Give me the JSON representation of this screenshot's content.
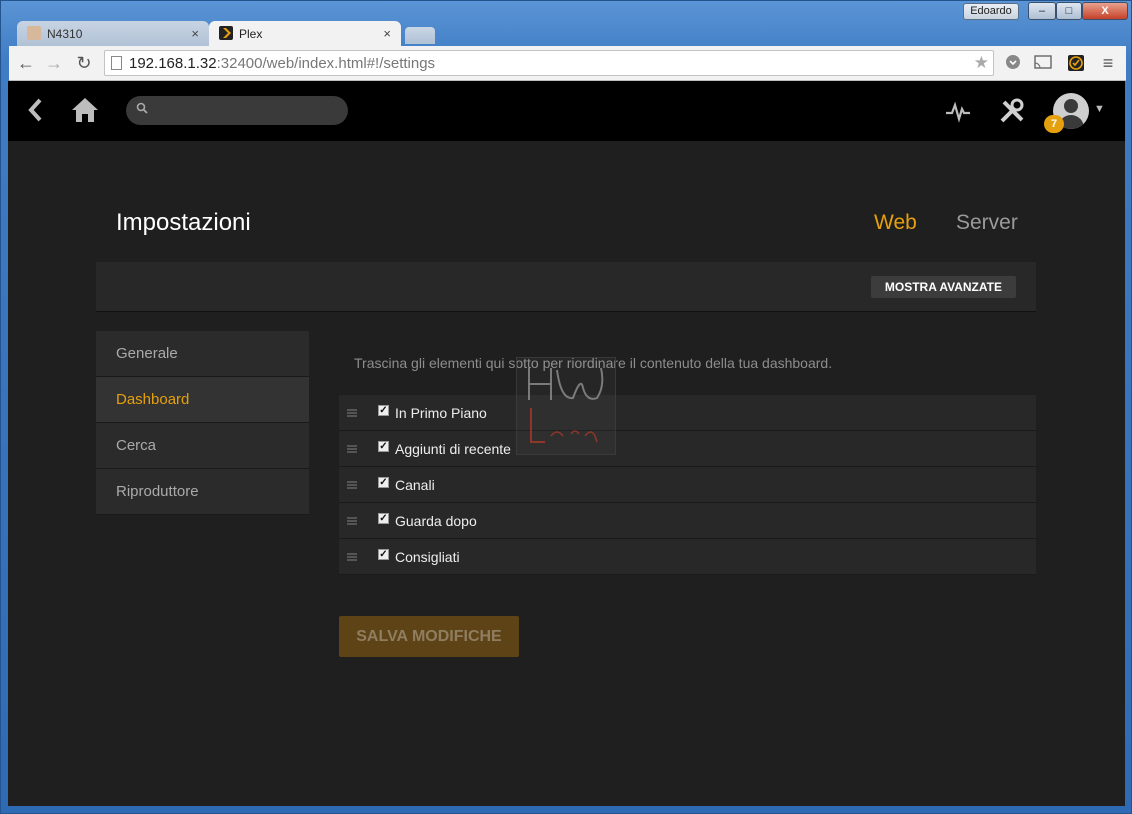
{
  "window": {
    "user_label": "Edoardo",
    "minimize_symbol": "–",
    "maximize_symbol": "□",
    "close_symbol": "X"
  },
  "tabs": [
    {
      "title": "N4310",
      "close": "×"
    },
    {
      "title": "Plex",
      "close": "×"
    }
  ],
  "browser": {
    "url_host": "192.168.1.32",
    "url_rest": ":32400/web/index.html#!/settings",
    "back_symbol": "←",
    "forward_symbol": "→",
    "reload_symbol": "↻",
    "star_symbol": "★",
    "menu_symbol": "≡"
  },
  "plex": {
    "notification_count": "7",
    "page_title": "Impostazioni",
    "tab_web": "Web",
    "tab_server": "Server",
    "show_advanced": "MOSTRA AVANZATE",
    "sidebar": [
      {
        "label": "Generale"
      },
      {
        "label": "Dashboard"
      },
      {
        "label": "Cerca"
      },
      {
        "label": "Riproduttore"
      }
    ],
    "hint": "Trascina gli elementi qui sotto per riordinare il contenuto della tua dashboard.",
    "items": [
      {
        "label": "In Primo Piano",
        "checked": true
      },
      {
        "label": "Aggiunti di recente",
        "checked": true
      },
      {
        "label": "Canali",
        "checked": true
      },
      {
        "label": "Guarda dopo",
        "checked": true
      },
      {
        "label": "Consigliati",
        "checked": true
      }
    ],
    "save_label": "SALVA MODIFICHE",
    "watermark_text": "HW Legend"
  },
  "colors": {
    "accent": "#e5a00d",
    "app_bg": "#1f1f1f",
    "topbar_bg": "#000000"
  }
}
